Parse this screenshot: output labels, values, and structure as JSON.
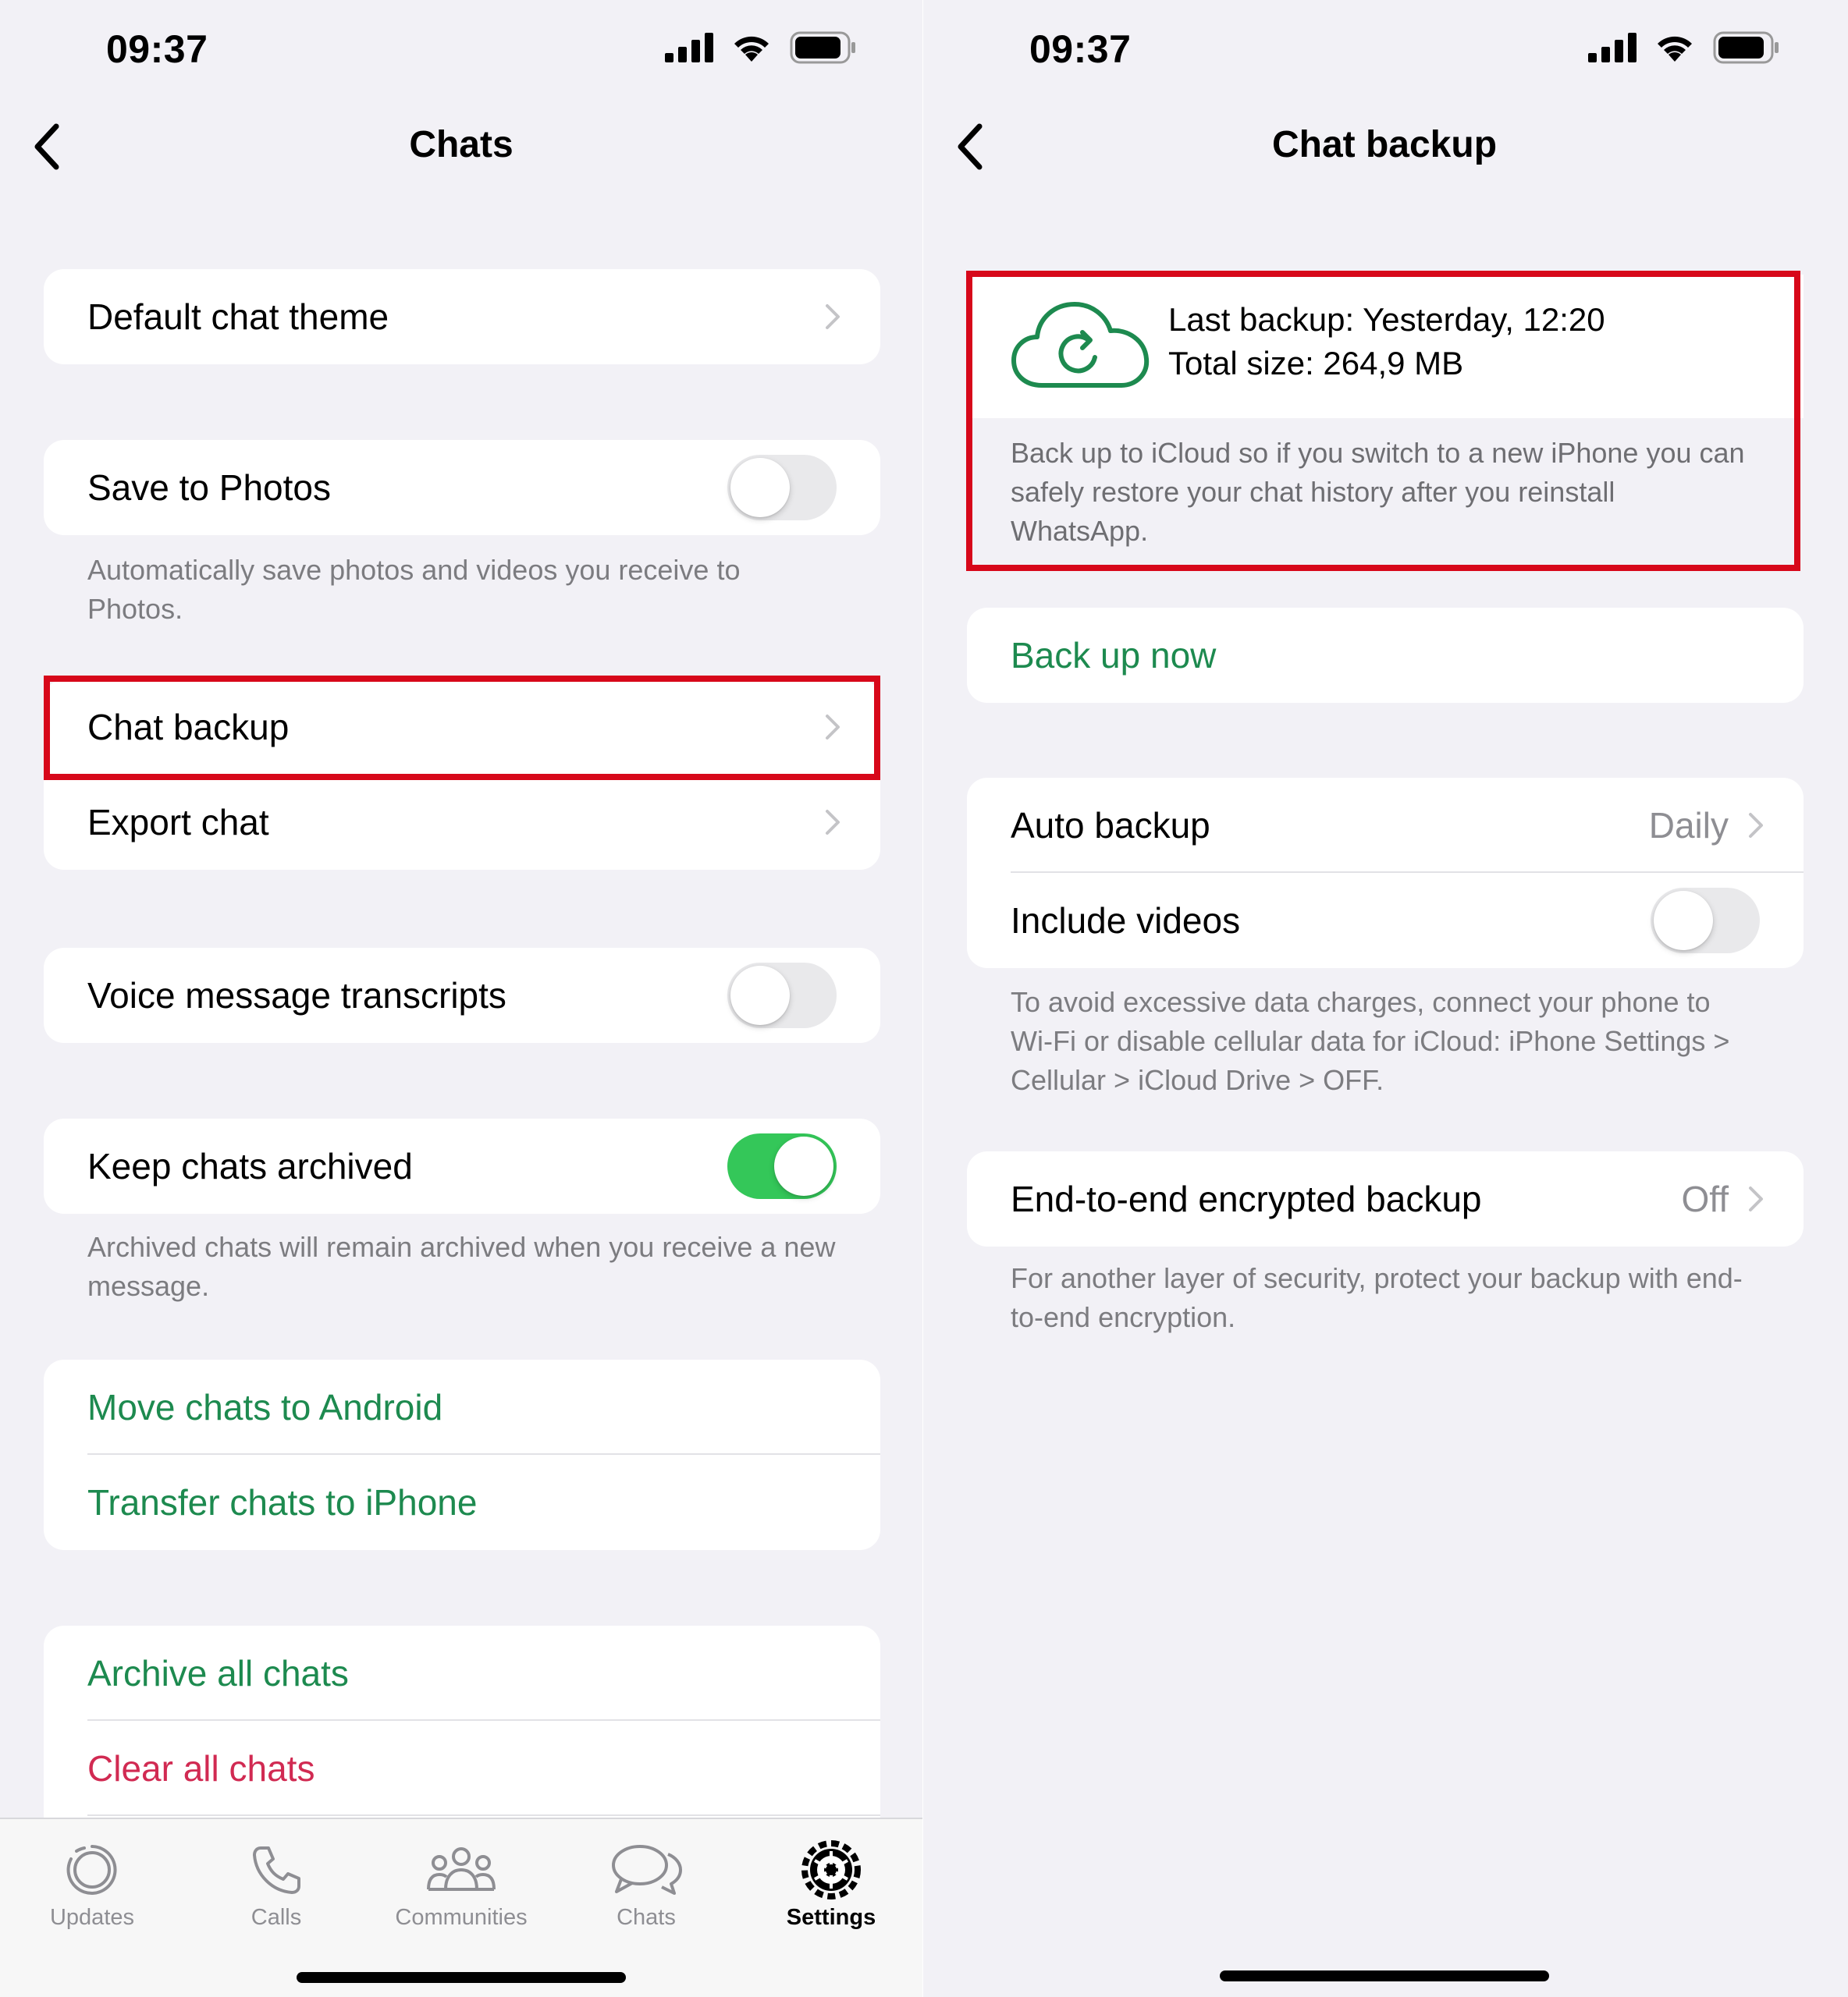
{
  "status_bar": {
    "time": "09:37"
  },
  "left": {
    "title": "Chats",
    "rows": {
      "default_theme": "Default chat theme",
      "save_photos": "Save to Photos",
      "save_photos_note": "Automatically save photos and videos you receive to Photos.",
      "chat_backup": "Chat backup",
      "export_chat": "Export chat",
      "voice_transcripts": "Voice message transcripts",
      "keep_archived": "Keep chats archived",
      "keep_archived_note": "Archived chats will remain archived when you receive a new message.",
      "move_android": "Move chats to Android",
      "transfer_iphone": "Transfer chats to iPhone",
      "archive_all": "Archive all chats",
      "clear_all": "Clear all chats"
    },
    "toggles": {
      "save_photos": false,
      "voice_transcripts": false,
      "keep_archived": true
    },
    "tabs": {
      "updates": "Updates",
      "calls": "Calls",
      "communities": "Communities",
      "chats": "Chats",
      "settings": "Settings"
    }
  },
  "right": {
    "title": "Chat backup",
    "last_backup": "Last backup: Yesterday, 12:20",
    "total_size": "Total size: 264,9 MB",
    "backup_description": "Back up to iCloud so if you switch to a new iPhone you can safely restore your chat history after you reinstall WhatsApp.",
    "back_up_now": "Back up now",
    "auto_backup": "Auto backup",
    "auto_backup_value": "Daily",
    "include_videos": "Include videos",
    "include_videos_on": false,
    "data_note": "To avoid excessive data charges, connect your phone to Wi-Fi or disable cellular data for iCloud: iPhone Settings > Cellular > iCloud Drive > OFF.",
    "e2e_backup": "End-to-end encrypted backup",
    "e2e_value": "Off",
    "e2e_note": "For another layer of security, protect your backup with end-to-end encryption."
  },
  "colors": {
    "accent_green": "#1d8a4f",
    "destructive_red": "#d12a52",
    "toggle_on": "#34c759",
    "highlight_red": "#d7081a",
    "background": "#f2f1f6"
  }
}
